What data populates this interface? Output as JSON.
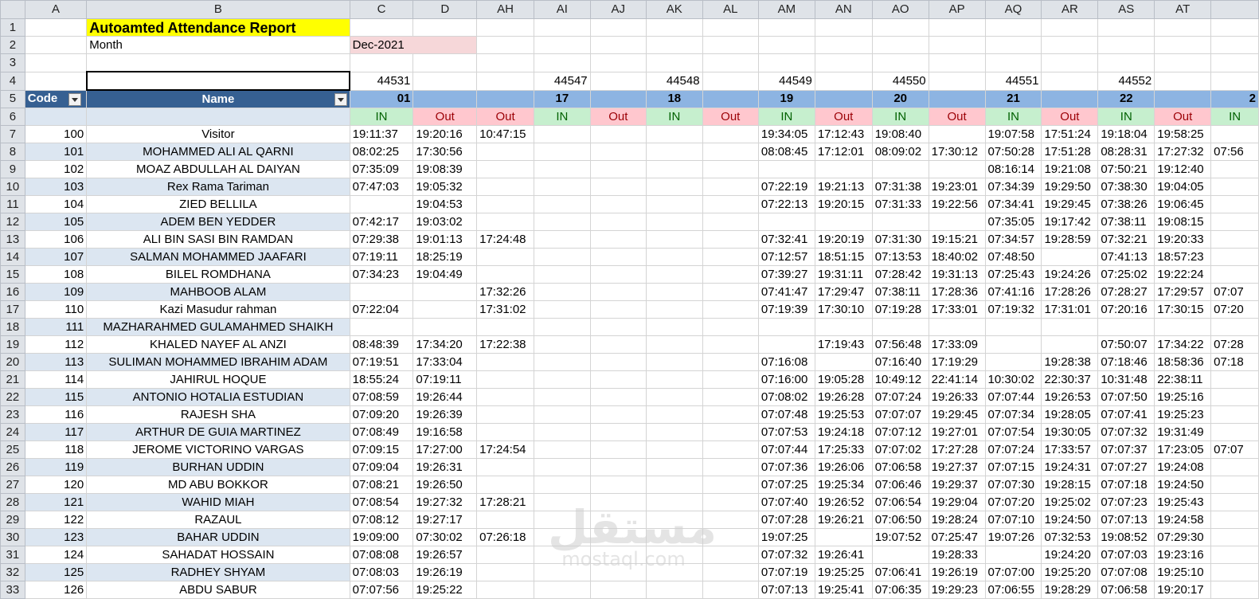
{
  "columns": [
    "A",
    "B",
    "C",
    "D",
    "AH",
    "AI",
    "AJ",
    "AK",
    "AL",
    "AM",
    "AN",
    "AO",
    "AP",
    "AQ",
    "AR",
    "AS",
    "AT",
    ""
  ],
  "title": "Autoamted Attendance Report",
  "month_label": "Month",
  "month_value": "Dec-2021",
  "serials": {
    "C": "44531",
    "AI": "44547",
    "AK": "44548",
    "AM": "44549",
    "AO": "44550",
    "AQ": "44551",
    "AS": "44552"
  },
  "header": {
    "code": "Code",
    "name": "Name",
    "days": {
      "C": "01",
      "AI": "17",
      "AK": "18",
      "AM": "19",
      "AO": "20",
      "AQ": "21",
      "AS": "22",
      "EXTRA": "2"
    }
  },
  "io": {
    "in": "IN",
    "out": "Out"
  },
  "rows": [
    {
      "num": "7",
      "code": "100",
      "name": "Visitor",
      "v": [
        "19:11:37",
        "19:20:16",
        "10:47:15",
        "",
        "",
        "",
        "",
        "19:34:05",
        "17:12:43",
        "19:08:40",
        "",
        "19:07:58",
        "17:51:24",
        "19:18:04",
        "19:58:25",
        ""
      ]
    },
    {
      "num": "8",
      "code": "101",
      "name": "MOHAMMED ALI AL QARNI",
      "v": [
        "08:02:25",
        "17:30:56",
        "",
        "",
        "",
        "",
        "",
        "08:08:45",
        "17:12:01",
        "08:09:02",
        "17:30:12",
        "07:50:28",
        "17:51:28",
        "08:28:31",
        "17:27:32",
        "07:56"
      ]
    },
    {
      "num": "9",
      "code": "102",
      "name": "MOAZ ABDULLAH AL DAIYAN",
      "v": [
        "07:35:09",
        "19:08:39",
        "",
        "",
        "",
        "",
        "",
        "",
        "",
        "",
        "",
        "08:16:14",
        "19:21:08",
        "07:50:21",
        "19:12:40",
        ""
      ]
    },
    {
      "num": "10",
      "code": "103",
      "name": "Rex Rama Tariman",
      "v": [
        "07:47:03",
        "19:05:32",
        "",
        "",
        "",
        "",
        "",
        "07:22:19",
        "19:21:13",
        "07:31:38",
        "19:23:01",
        "07:34:39",
        "19:29:50",
        "07:38:30",
        "19:04:05",
        ""
      ]
    },
    {
      "num": "11",
      "code": "104",
      "name": "ZIED BELLILA",
      "v": [
        "",
        "19:04:53",
        "",
        "",
        "",
        "",
        "",
        "07:22:13",
        "19:20:15",
        "07:31:33",
        "19:22:56",
        "07:34:41",
        "19:29:45",
        "07:38:26",
        "19:06:45",
        ""
      ]
    },
    {
      "num": "12",
      "code": "105",
      "name": "ADEM BEN YEDDER",
      "v": [
        "07:42:17",
        "19:03:02",
        "",
        "",
        "",
        "",
        "",
        "",
        "",
        "",
        "",
        "07:35:05",
        "19:17:42",
        "07:38:11",
        "19:08:15",
        ""
      ]
    },
    {
      "num": "13",
      "code": "106",
      "name": "ALI BIN SASI BIN RAMDAN",
      "v": [
        "07:29:38",
        "19:01:13",
        "17:24:48",
        "",
        "",
        "",
        "",
        "07:32:41",
        "19:20:19",
        "07:31:30",
        "19:15:21",
        "07:34:57",
        "19:28:59",
        "07:32:21",
        "19:20:33",
        ""
      ]
    },
    {
      "num": "14",
      "code": "107",
      "name": "SALMAN MOHAMMED JAAFARI",
      "v": [
        "07:19:11",
        "18:25:19",
        "",
        "",
        "",
        "",
        "",
        "07:12:57",
        "18:51:15",
        "07:13:53",
        "18:40:02",
        "07:48:50",
        "",
        "07:41:13",
        "18:57:23",
        ""
      ]
    },
    {
      "num": "15",
      "code": "108",
      "name": "BILEL ROMDHANA",
      "v": [
        "07:34:23",
        "19:04:49",
        "",
        "",
        "",
        "",
        "",
        "07:39:27",
        "19:31:11",
        "07:28:42",
        "19:31:13",
        "07:25:43",
        "19:24:26",
        "07:25:02",
        "19:22:24",
        ""
      ]
    },
    {
      "num": "16",
      "code": "109",
      "name": "MAHBOOB ALAM",
      "v": [
        "",
        "",
        "17:32:26",
        "",
        "",
        "",
        "",
        "07:41:47",
        "17:29:47",
        "07:38:11",
        "17:28:36",
        "07:41:16",
        "17:28:26",
        "07:28:27",
        "17:29:57",
        "07:07"
      ]
    },
    {
      "num": "17",
      "code": "110",
      "name": "Kazi Masudur rahman",
      "v": [
        "07:22:04",
        "",
        "17:31:02",
        "",
        "",
        "",
        "",
        "07:19:39",
        "17:30:10",
        "07:19:28",
        "17:33:01",
        "07:19:32",
        "17:31:01",
        "07:20:16",
        "17:30:15",
        "07:20"
      ]
    },
    {
      "num": "18",
      "code": "111",
      "name": "MAZHARAHMED GULAMAHMED SHAIKH",
      "v": [
        "",
        "",
        "",
        "",
        "",
        "",
        "",
        "",
        "",
        "",
        "",
        "",
        "",
        "",
        "",
        ""
      ]
    },
    {
      "num": "19",
      "code": "112",
      "name": "KHALED NAYEF AL ANZI",
      "v": [
        "08:48:39",
        "17:34:20",
        "17:22:38",
        "",
        "",
        "",
        "",
        "",
        "17:19:43",
        "07:56:48",
        "17:33:09",
        "",
        "",
        "07:50:07",
        "17:34:22",
        "07:28"
      ]
    },
    {
      "num": "20",
      "code": "113",
      "name": "SULIMAN MOHAMMED IBRAHIM ADAM",
      "v": [
        "07:19:51",
        "17:33:04",
        "",
        "",
        "",
        "",
        "",
        "07:16:08",
        "",
        "07:16:40",
        "17:19:29",
        "",
        "19:28:38",
        "07:18:46",
        "18:58:36",
        "07:18"
      ]
    },
    {
      "num": "21",
      "code": "114",
      "name": "JAHIRUL HOQUE",
      "v": [
        "18:55:24",
        "07:19:11",
        "",
        "",
        "",
        "",
        "",
        "07:16:00",
        "19:05:28",
        "10:49:12",
        "22:41:14",
        "10:30:02",
        "22:30:37",
        "10:31:48",
        "22:38:11",
        ""
      ]
    },
    {
      "num": "22",
      "code": "115",
      "name": "ANTONIO HOTALIA ESTUDIAN",
      "v": [
        "07:08:59",
        "19:26:44",
        "",
        "",
        "",
        "",
        "",
        "07:08:02",
        "19:26:28",
        "07:07:24",
        "19:26:33",
        "07:07:44",
        "19:26:53",
        "07:07:50",
        "19:25:16",
        ""
      ]
    },
    {
      "num": "23",
      "code": "116",
      "name": "RAJESH SHA",
      "v": [
        "07:09:20",
        "19:26:39",
        "",
        "",
        "",
        "",
        "",
        "07:07:48",
        "19:25:53",
        "07:07:07",
        "19:29:45",
        "07:07:34",
        "19:28:05",
        "07:07:41",
        "19:25:23",
        ""
      ]
    },
    {
      "num": "24",
      "code": "117",
      "name": "ARTHUR DE GUIA MARTINEZ",
      "v": [
        "07:08:49",
        "19:16:58",
        "",
        "",
        "",
        "",
        "",
        "07:07:53",
        "19:24:18",
        "07:07:12",
        "19:27:01",
        "07:07:54",
        "19:30:05",
        "07:07:32",
        "19:31:49",
        ""
      ]
    },
    {
      "num": "25",
      "code": "118",
      "name": "JEROME VICTORINO VARGAS",
      "v": [
        "07:09:15",
        "17:27:00",
        "17:24:54",
        "",
        "",
        "",
        "",
        "07:07:44",
        "17:25:33",
        "07:07:02",
        "17:27:28",
        "07:07:24",
        "17:33:57",
        "07:07:37",
        "17:23:05",
        "07:07"
      ]
    },
    {
      "num": "26",
      "code": "119",
      "name": "BURHAN UDDIN",
      "v": [
        "07:09:04",
        "19:26:31",
        "",
        "",
        "",
        "",
        "",
        "07:07:36",
        "19:26:06",
        "07:06:58",
        "19:27:37",
        "07:07:15",
        "19:24:31",
        "07:07:27",
        "19:24:08",
        ""
      ]
    },
    {
      "num": "27",
      "code": "120",
      "name": "MD ABU BOKKOR",
      "v": [
        "07:08:21",
        "19:26:50",
        "",
        "",
        "",
        "",
        "",
        "07:07:25",
        "19:25:34",
        "07:06:46",
        "19:29:37",
        "07:07:30",
        "19:28:15",
        "07:07:18",
        "19:24:50",
        ""
      ]
    },
    {
      "num": "28",
      "code": "121",
      "name": "WAHID MIAH",
      "v": [
        "07:08:54",
        "19:27:32",
        "17:28:21",
        "",
        "",
        "",
        "",
        "07:07:40",
        "19:26:52",
        "07:06:54",
        "19:29:04",
        "07:07:20",
        "19:25:02",
        "07:07:23",
        "19:25:43",
        ""
      ]
    },
    {
      "num": "29",
      "code": "122",
      "name": "RAZAUL",
      "v": [
        "07:08:12",
        "19:27:17",
        "",
        "",
        "",
        "",
        "",
        "07:07:28",
        "19:26:21",
        "07:06:50",
        "19:28:24",
        "07:07:10",
        "19:24:50",
        "07:07:13",
        "19:24:58",
        ""
      ]
    },
    {
      "num": "30",
      "code": "123",
      "name": "BAHAR UDDIN",
      "v": [
        "19:09:00",
        "07:30:02",
        "07:26:18",
        "",
        "",
        "",
        "",
        "19:07:25",
        "",
        "19:07:52",
        "07:25:47",
        "19:07:26",
        "07:32:53",
        "19:08:52",
        "07:29:30",
        ""
      ]
    },
    {
      "num": "31",
      "code": "124",
      "name": "SAHADAT HOSSAIN",
      "v": [
        "07:08:08",
        "19:26:57",
        "",
        "",
        "",
        "",
        "",
        "07:07:32",
        "19:26:41",
        "",
        "19:28:33",
        "",
        "19:24:20",
        "07:07:03",
        "19:23:16",
        ""
      ]
    },
    {
      "num": "32",
      "code": "125",
      "name": "RADHEY SHYAM",
      "v": [
        "07:08:03",
        "19:26:19",
        "",
        "",
        "",
        "",
        "",
        "07:07:19",
        "19:25:25",
        "07:06:41",
        "19:26:19",
        "07:07:00",
        "19:25:20",
        "07:07:08",
        "19:25:10",
        ""
      ]
    },
    {
      "num": "33",
      "code": "126",
      "name": "ABDU SABUR",
      "v": [
        "07:07:56",
        "19:25:22",
        "",
        "",
        "",
        "",
        "",
        "07:07:13",
        "19:25:41",
        "07:06:35",
        "19:29:23",
        "07:06:55",
        "19:28:29",
        "07:06:58",
        "19:20:17",
        ""
      ]
    }
  ],
  "watermark": {
    "arabic": "مستقل",
    "latin": "mostaql.com"
  }
}
